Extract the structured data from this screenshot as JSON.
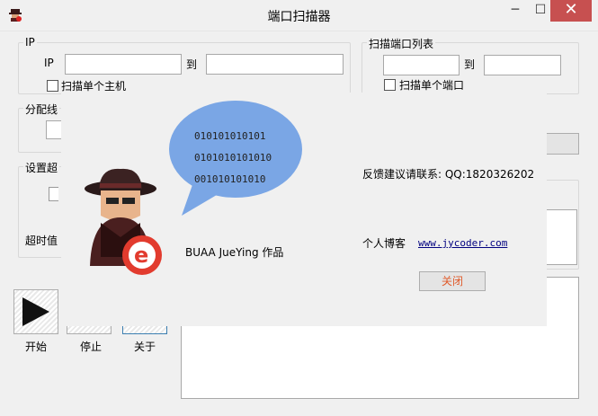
{
  "window": {
    "title": "端口扫描器",
    "min": "─",
    "max": "☐",
    "close": "✕"
  },
  "ip_group": {
    "legend": "IP",
    "ip_label": "IP",
    "to_label": "到",
    "from_value": "",
    "to_value": "",
    "single_host": "扫描单个主机"
  },
  "port_group": {
    "legend": "扫描端口列表",
    "to_label": "到",
    "from_value": "",
    "to_value": "",
    "single_port": "扫描单个端口"
  },
  "thread_group": {
    "legend": "分配线"
  },
  "settings_group": {
    "legend": "设置超",
    "timeout_label": "超时值"
  },
  "buttons": {
    "start": "开始",
    "stop": "停止",
    "about": "关于"
  },
  "about": {
    "binary": [
      "010101010101",
      "0101010101010",
      "001010101010"
    ],
    "author": "BUAA JueYing 作品",
    "feedback": "反馈建议请联系: QQ:1820326202",
    "blog_label": "个人博客",
    "blog_link": "www.jycoder.com",
    "close": "关闭"
  },
  "colors": {
    "bubble": "#7aa6e5",
    "close_accent": "#c75050",
    "link": "#00007f",
    "close_button_text": "#e05a2a"
  }
}
